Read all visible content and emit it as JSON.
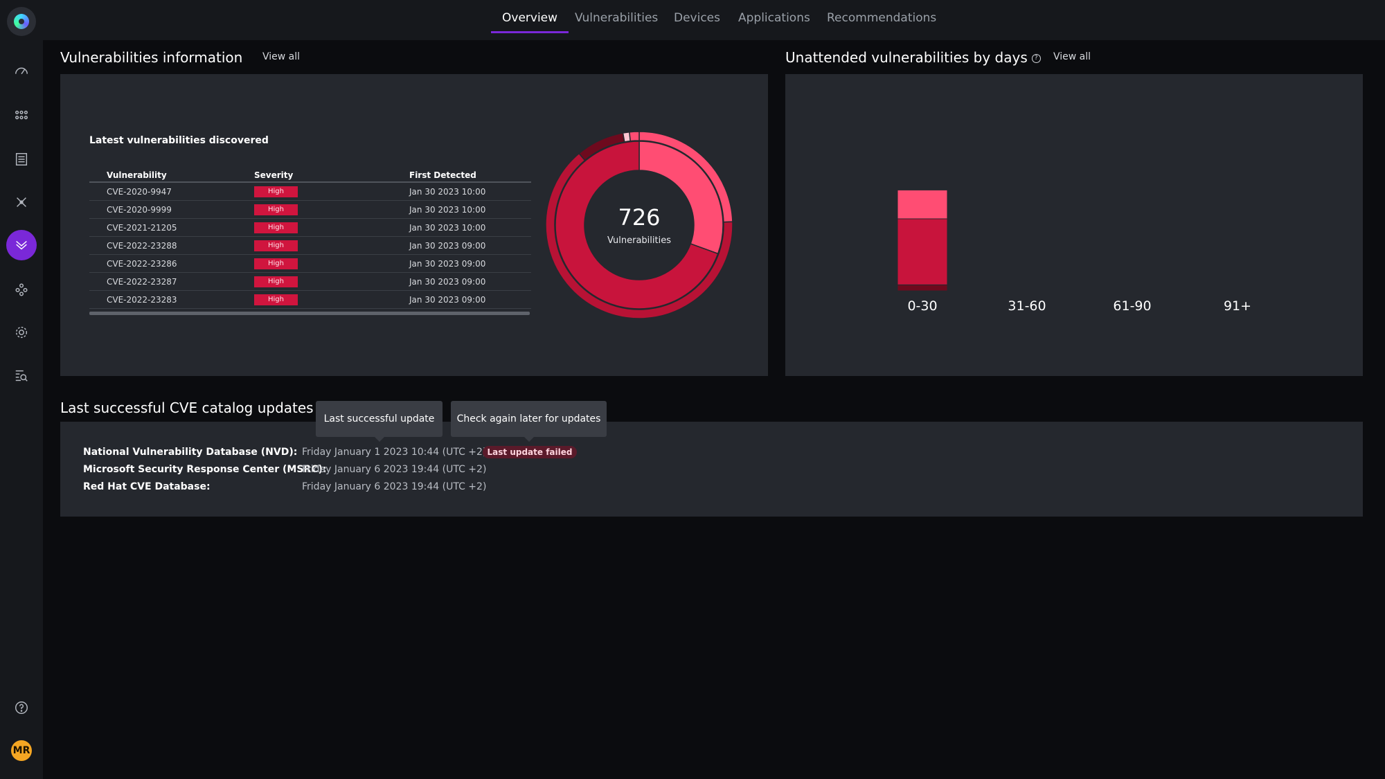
{
  "nav": {
    "tabs": [
      {
        "label": "Overview",
        "active": true
      },
      {
        "label": "Vulnerabilities",
        "active": false
      },
      {
        "label": "Devices",
        "active": false
      },
      {
        "label": "Applications",
        "active": false
      },
      {
        "label": "Recommendations",
        "active": false
      }
    ]
  },
  "sidebar": {
    "icons": [
      "logo-icon",
      "gauge-icon",
      "grid-icon",
      "list-icon",
      "crosshair-icon",
      "vulnerability-icon",
      "nodes-icon",
      "gear-icon",
      "search-list-icon",
      "help-icon"
    ],
    "active_icon": "vulnerability-icon",
    "avatar_initials": "MR"
  },
  "vuln_info": {
    "title": "Vulnerabilities information",
    "view_all": "View all",
    "table_title": "Latest vulnerabilities discovered",
    "columns": [
      "Vulnerability",
      "Severity",
      "First Detected"
    ],
    "rows": [
      {
        "id": "CVE-2020-9947",
        "severity": "High",
        "detected": "Jan 30 2023 10:00"
      },
      {
        "id": "CVE-2020-9999",
        "severity": "High",
        "detected": "Jan 30 2023 10:00"
      },
      {
        "id": "CVE-2021-21205",
        "severity": "High",
        "detected": "Jan 30 2023 10:00"
      },
      {
        "id": "CVE-2022-23288",
        "severity": "High",
        "detected": "Jan 30 2023 09:00"
      },
      {
        "id": "CVE-2022-23286",
        "severity": "High",
        "detected": "Jan 30 2023 09:00"
      },
      {
        "id": "CVE-2022-23287",
        "severity": "High",
        "detected": "Jan 30 2023 09:00"
      },
      {
        "id": "CVE-2022-23283",
        "severity": "High",
        "detected": "Jan 30 2023 09:00"
      }
    ],
    "total": "726",
    "total_label": "Vulnerabilities"
  },
  "unattended": {
    "title": "Unattended vulnerabilities by days",
    "view_all": "View all"
  },
  "chart_data": [
    {
      "type": "pie",
      "center_label": "726 Vulnerabilities",
      "outer_ring": [
        {
          "color": "#ff4d73",
          "value": 88
        },
        {
          "color": "#b81235",
          "value": 232
        },
        {
          "color": "#6e0a1e",
          "value": 30
        },
        {
          "color": "#ffc6d2",
          "value": 4
        },
        {
          "color": "#ff4d73",
          "value": 6
        }
      ],
      "inner_ring": [
        {
          "color": "#ff4d73",
          "value": 110
        },
        {
          "color": "#c8143c",
          "value": 250
        }
      ]
    },
    {
      "type": "bar",
      "categories": [
        "0-30",
        "31-60",
        "61-90",
        "91+"
      ],
      "series": [
        {
          "color": "#6e0a1e",
          "values": [
            10,
            0,
            0,
            0
          ]
        },
        {
          "color": "#c8143c",
          "values": [
            110,
            0,
            0,
            0
          ]
        },
        {
          "color": "#ff4d73",
          "values": [
            48,
            0,
            0,
            0
          ]
        }
      ],
      "ylim": [
        0,
        300
      ]
    }
  ],
  "cve_updates": {
    "title": "Last successful CVE catalog updates",
    "tooltip_left": "Last successful update",
    "tooltip_right": "Check again later for updates",
    "rows": [
      {
        "name": "National Vulnerability Database (NVD):",
        "date": "Friday January 1 2023 10:44 (UTC +2)"
      },
      {
        "name": "Microsoft Security Response Center (MSRC):",
        "date": "Friday January 6 2023 19:44 (UTC +2)"
      },
      {
        "name": "Red Hat CVE Database:",
        "date": "Friday January 6 2023 19:44 (UTC +2)"
      }
    ],
    "fail_badge": "Last update failed"
  }
}
